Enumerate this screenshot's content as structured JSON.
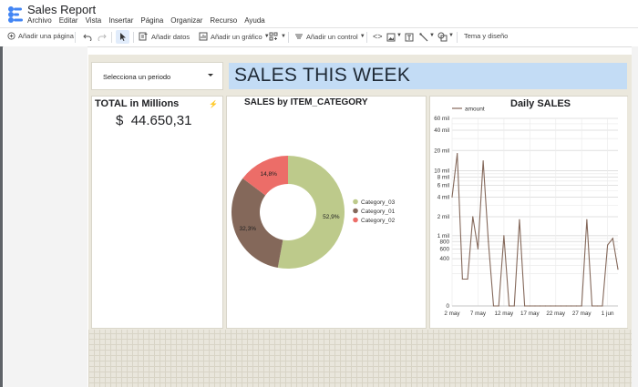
{
  "app": {
    "title": "Sales Report",
    "menu": [
      "Archivo",
      "Editar",
      "Vista",
      "Insertar",
      "Página",
      "Organizar",
      "Recurso",
      "Ayuda"
    ]
  },
  "toolbar": {
    "add_page": "Añadir una página",
    "add_data": "Añadir datos",
    "add_chart": "Añadir un gráfico",
    "add_control": "Añadir un control",
    "theme_layout": "Tema y diseño"
  },
  "report": {
    "period_selector": "Selecciona un periodo",
    "banner": "SALES THIS WEEK",
    "total": {
      "title": "TOTAL in Millions",
      "currency": "$",
      "value": "44.650,31"
    }
  },
  "colors": {
    "accent_banner": "#c3dcf5",
    "cat03": "#bdca8b",
    "cat01": "#84685a",
    "cat02": "#ec6d68",
    "line": "#84685a"
  },
  "chart_data": [
    {
      "type": "pie",
      "donut": true,
      "title": "SALES by ITEM_CATEGORY",
      "legend_position": "right",
      "slices": [
        {
          "name": "Category_03",
          "label": "52,9%",
          "value": 52.9,
          "color": "#bdca8b"
        },
        {
          "name": "Category_01",
          "label": "32,3%",
          "value": 32.3,
          "color": "#84685a"
        },
        {
          "name": "Category_02",
          "label": "14,8%",
          "value": 14.8,
          "color": "#ec6d68"
        }
      ]
    },
    {
      "type": "line",
      "title": "Daily SALES",
      "legend_position": "top-left",
      "y_scale": "log",
      "grid": true,
      "series": [
        {
          "name": "amount",
          "color": "#84685a",
          "x": [
            "2 may",
            "3 may",
            "4 may",
            "5 may",
            "6 may",
            "7 may",
            "8 may",
            "9 may",
            "10 may",
            "11 may",
            "12 may",
            "13 may",
            "14 may",
            "15 may",
            "16 may",
            "17 may",
            "18 may",
            "19 may",
            "20 may",
            "21 may",
            "22 may",
            "23 may",
            "24 may",
            "25 may",
            "26 may",
            "27 may",
            "28 may",
            "29 may",
            "30 may",
            "31 may",
            "1 jun",
            "2 jun",
            "3 jun"
          ],
          "values": [
            4000,
            18000,
            150,
            150,
            2000,
            600,
            14000,
            800,
            0,
            0,
            1000,
            0,
            0,
            1800,
            0,
            0,
            0,
            0,
            0,
            0,
            0,
            0,
            0,
            0,
            0,
            0,
            1800,
            0,
            0,
            0,
            700,
            900,
            250
          ]
        }
      ],
      "y_ticks": [
        {
          "v": 0,
          "label": "0"
        },
        {
          "v": 400,
          "label": "400"
        },
        {
          "v": 600,
          "label": "600"
        },
        {
          "v": 800,
          "label": "800"
        },
        {
          "v": 1000,
          "label": "1 mil"
        },
        {
          "v": 2000,
          "label": "2 mil"
        },
        {
          "v": 4000,
          "label": "4 mil"
        },
        {
          "v": 6000,
          "label": "6 mil"
        },
        {
          "v": 8000,
          "label": "8 mil"
        },
        {
          "v": 10000,
          "label": "10 mil"
        },
        {
          "v": 20000,
          "label": "20 mil"
        },
        {
          "v": 40000,
          "label": "40 mil"
        },
        {
          "v": 60000,
          "label": "60 mil"
        }
      ],
      "x_ticks": [
        "2 may",
        "7 may",
        "12 may",
        "17 may",
        "22 may",
        "27 may",
        "1 jun"
      ]
    }
  ]
}
